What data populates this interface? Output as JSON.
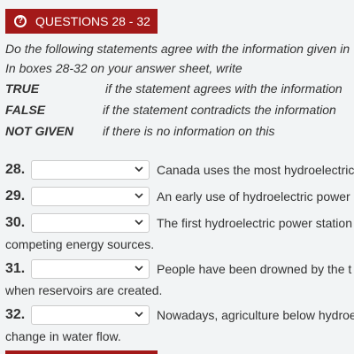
{
  "header": {
    "title": "QUESTIONS 28 - 32",
    "icon": "question-circle-icon",
    "color": "#a31919"
  },
  "instructions": {
    "line1": "Do the following statements agree with the information given in",
    "line2": "In boxes 28-32 on your answer sheet, write"
  },
  "legend": [
    {
      "key": "TRUE",
      "desc": "if the statement agrees with the information"
    },
    {
      "key": "FALSE",
      "desc": "if the statement contradicts the information"
    },
    {
      "key": "NOT GIVEN",
      "desc": "if there is no information on this"
    }
  ],
  "questions": [
    {
      "number": "28.",
      "selected": "",
      "text": "Canada uses the most hydroelectric",
      "cont": ""
    },
    {
      "number": "29.",
      "selected": "",
      "text": "An early use of hydroelectric power",
      "cont": ""
    },
    {
      "number": "30.",
      "selected": "",
      "text": "The first hydroelectric power station",
      "cont": "competing energy sources."
    },
    {
      "number": "31.",
      "selected": "",
      "text": "People have been drowned by the t",
      "cont": "when reservoirs are created."
    },
    {
      "number": "32.",
      "selected": "",
      "text": "Nowadays, agriculture below hydroe",
      "cont": "change in water flow."
    }
  ]
}
